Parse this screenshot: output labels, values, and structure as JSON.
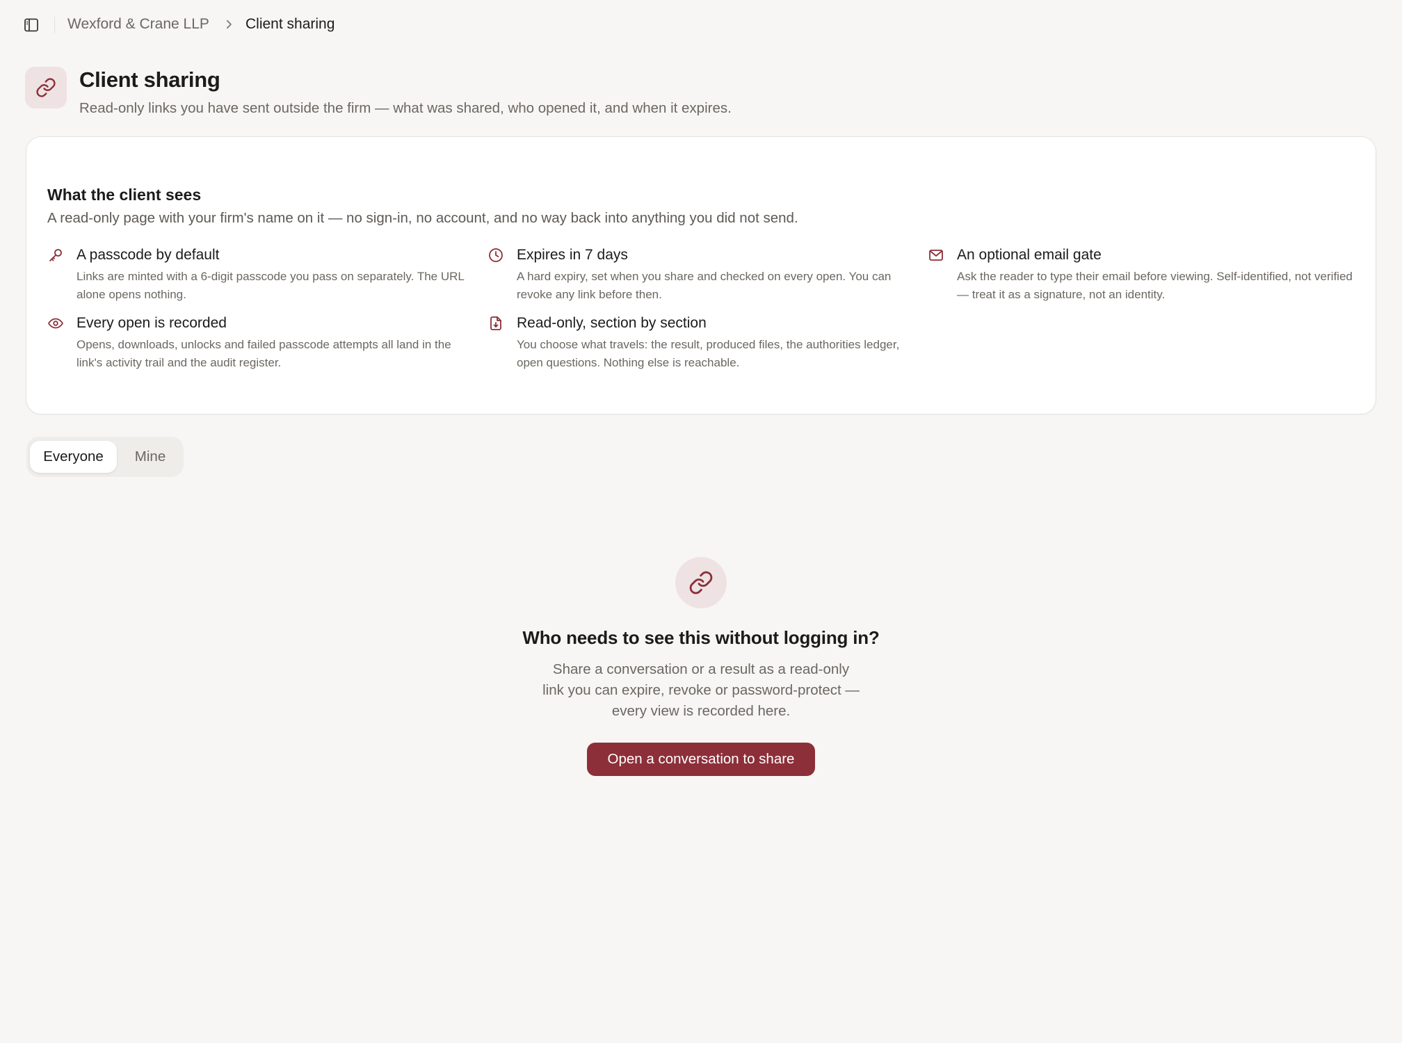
{
  "breadcrumb": {
    "firm": "Wexford & Crane LLP",
    "current": "Client sharing"
  },
  "header": {
    "icon": "link-icon",
    "title": "Client sharing",
    "subtitle": "Read-only links you have sent outside the firm — what was shared, who opened it, and when it expires."
  },
  "info_card": {
    "title": "What the client sees",
    "subtitle": "A read-only page with your firm's name on it — no sign-in, no account, and no way back into anything you did not send.",
    "features": [
      {
        "icon": "key-icon",
        "title": "A passcode by default",
        "description": "Links are minted with a 6-digit passcode you pass on separately. The URL alone opens nothing."
      },
      {
        "icon": "clock-icon",
        "title": "Expires in 7 days",
        "description": "A hard expiry, set when you share and checked on every open. You can revoke any link before then."
      },
      {
        "icon": "mail-icon",
        "title": "An optional email gate",
        "description": "Ask the reader to type their email before viewing. Self-identified, not verified — treat it as a signature, not an identity."
      },
      {
        "icon": "eye-icon",
        "title": "Every open is recorded",
        "description": "Opens, downloads, unlocks and failed passcode attempts all land in the link's activity trail and the audit register."
      },
      {
        "icon": "file-download-icon",
        "title": "Read-only, section by section",
        "description": "You choose what travels: the result, produced files, the authorities ledger, open questions. Nothing else is reachable."
      }
    ]
  },
  "filter": {
    "options": [
      "Everyone",
      "Mine"
    ],
    "selected": "Everyone"
  },
  "empty_state": {
    "icon": "link-icon",
    "title": "Who needs to see this without logging in?",
    "description": "Share a conversation or a result as a read-only link you can expire, revoke or password-protect — every view is recorded here.",
    "button_label": "Open a conversation to share"
  },
  "colors": {
    "accent": "#8c2f39",
    "accent_soft": "#efe2e3",
    "background": "#f7f6f4"
  }
}
